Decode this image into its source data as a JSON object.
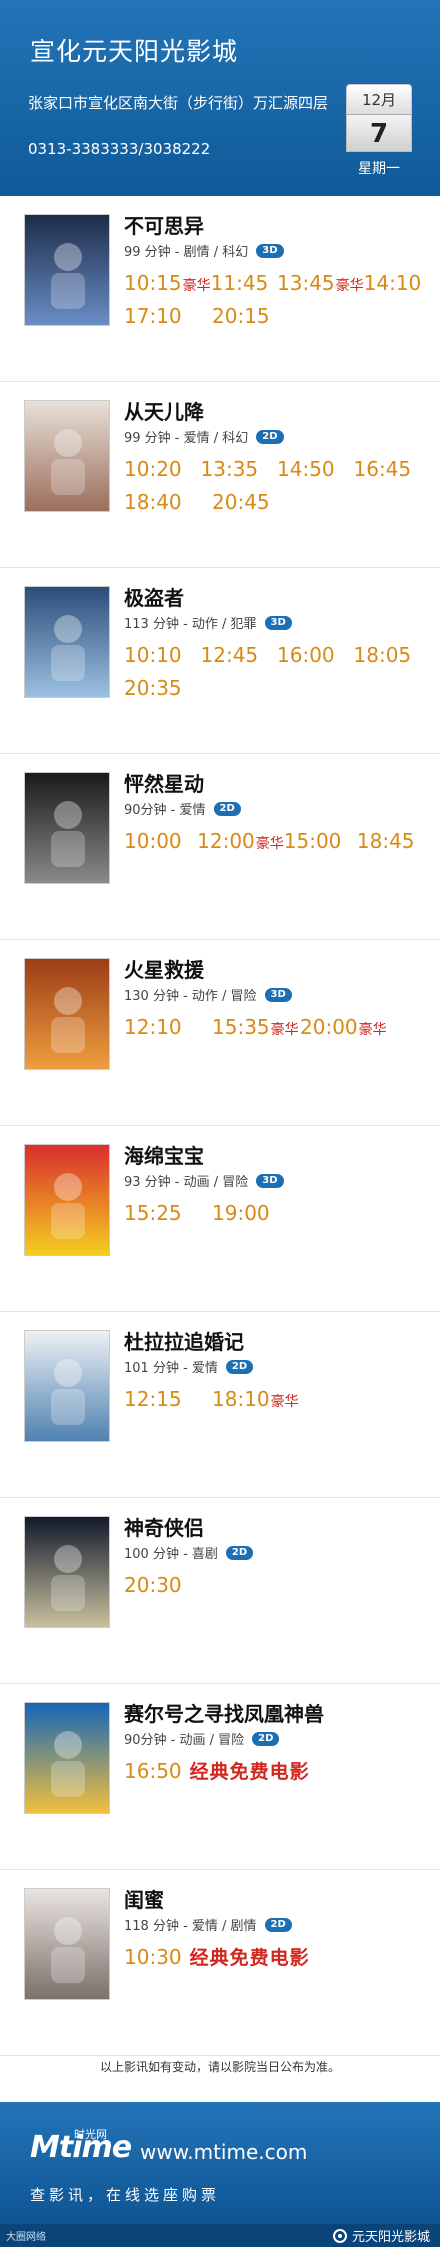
{
  "header": {
    "cinema_name": "宣化元天阳光影城",
    "address": "张家口市宣化区南大街（步行街）万汇源四层",
    "phone": "0313-3383333/3038222",
    "calendar": {
      "month": "12月",
      "day": "7",
      "weekday": "星期一"
    }
  },
  "colors": {
    "brand_blue": "#1a67aa",
    "showtime": "#d98a14",
    "tag_red": "#d0281e"
  },
  "films": [
    {
      "title": "不可思异",
      "meta": "99 分钟 - 剧情 / 科幻",
      "format": "3D",
      "poster_icon": "poster-image",
      "rows": [
        [
          {
            "t": "10:15",
            "tag": "豪华"
          },
          {
            "t": "11:45",
            "tag": ""
          },
          {
            "t": "13:45",
            "tag": "豪华"
          },
          {
            "t": "14:10",
            "tag": ""
          }
        ],
        [
          {
            "t": "17:10",
            "tag": ""
          },
          {
            "t": "20:15",
            "tag": ""
          }
        ]
      ]
    },
    {
      "title": "从天儿降",
      "meta": "99 分钟 - 爱情 / 科幻",
      "format": "2D",
      "poster_icon": "poster-image",
      "rows": [
        [
          {
            "t": "10:20",
            "tag": ""
          },
          {
            "t": "13:35",
            "tag": ""
          },
          {
            "t": "14:50",
            "tag": ""
          },
          {
            "t": "16:45",
            "tag": ""
          }
        ],
        [
          {
            "t": "18:40",
            "tag": ""
          },
          {
            "t": "20:45",
            "tag": ""
          }
        ]
      ]
    },
    {
      "title": "极盗者",
      "meta": "113 分钟 - 动作 / 犯罪",
      "format": "3D",
      "poster_icon": "poster-image",
      "rows": [
        [
          {
            "t": "10:10",
            "tag": ""
          },
          {
            "t": "12:45",
            "tag": ""
          },
          {
            "t": "16:00",
            "tag": ""
          },
          {
            "t": "18:05",
            "tag": ""
          }
        ],
        [
          {
            "t": "20:35",
            "tag": ""
          }
        ]
      ]
    },
    {
      "title": "怦然星动",
      "meta": "90分钟 - 爱情",
      "format": "2D",
      "poster_icon": "poster-image",
      "rows": [
        [
          {
            "t": "10:00",
            "tag": ""
          },
          {
            "t": "12:00",
            "tag": "豪华"
          },
          {
            "t": "15:00",
            "tag": ""
          },
          {
            "t": "18:45",
            "tag": ""
          }
        ]
      ]
    },
    {
      "title": "火星救援",
      "meta": "130 分钟 - 动作 / 冒险",
      "format": "3D",
      "poster_icon": "poster-image",
      "rows": [
        [
          {
            "t": "12:10",
            "tag": ""
          },
          {
            "t": "15:35",
            "tag": "豪华"
          },
          {
            "t": "20:00",
            "tag": "豪华"
          }
        ]
      ]
    },
    {
      "title": "海绵宝宝",
      "meta": "93 分钟 - 动画 / 冒险",
      "format": "3D",
      "poster_icon": "poster-image",
      "rows": [
        [
          {
            "t": "15:25",
            "tag": ""
          },
          {
            "t": "19:00",
            "tag": ""
          }
        ]
      ]
    },
    {
      "title": "杜拉拉追婚记",
      "meta": "101 分钟 - 爱情",
      "format": "2D",
      "poster_icon": "poster-image",
      "rows": [
        [
          {
            "t": "12:15",
            "tag": ""
          },
          {
            "t": "18:10",
            "tag": "豪华"
          }
        ]
      ]
    },
    {
      "title": "神奇侠侣",
      "meta": "100 分钟 - 喜剧",
      "format": "2D",
      "poster_icon": "poster-image",
      "rows": [
        [
          {
            "t": "20:30",
            "tag": ""
          }
        ]
      ]
    },
    {
      "title": "赛尔号之寻找凤凰神兽",
      "meta": "90分钟 - 动画 / 冒险",
      "format": "2D",
      "poster_icon": "poster-image",
      "free": {
        "t": "16:50",
        "label": "经典免费电影"
      }
    },
    {
      "title": "闺蜜",
      "meta": "118 分钟 - 爱情 / 剧情",
      "format": "2D",
      "poster_icon": "poster-image",
      "free": {
        "t": "10:30",
        "label": "经典免费电影"
      }
    }
  ],
  "notice": "以上影讯如有变动，请以影院当日公布为准。",
  "footer": {
    "logo": "Mtime",
    "logo_sub": "时光网",
    "url": "www.mtime.com",
    "tagline": "查影讯，在线选座购票",
    "watermark_left": "大圈网络",
    "watermark_right": "元天阳光影城"
  }
}
